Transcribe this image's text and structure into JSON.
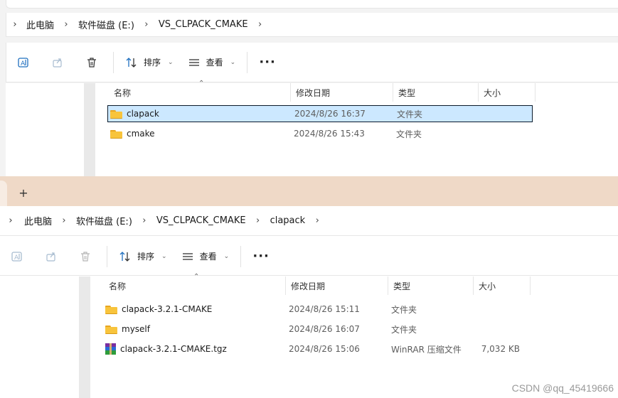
{
  "window_top": {
    "breadcrumb": [
      "此电脑",
      "软件磁盘 (E:)",
      "VS_CLPACK_CMAKE"
    ],
    "toolbar": {
      "sort_label": "排序",
      "view_label": "查看",
      "more_label": "···"
    },
    "columns": {
      "name": "名称",
      "date": "修改日期",
      "type": "类型",
      "size": "大小"
    },
    "files": [
      {
        "name": "clapack",
        "date": "2024/8/26 16:37",
        "type": "文件夹",
        "size": "",
        "icon": "folder-icon",
        "selected": true
      },
      {
        "name": "cmake",
        "date": "2024/8/26 15:43",
        "type": "文件夹",
        "size": "",
        "icon": "folder-icon",
        "selected": false
      }
    ]
  },
  "window_bottom": {
    "new_tab_label": "+",
    "breadcrumb": [
      "此电脑",
      "软件磁盘 (E:)",
      "VS_CLPACK_CMAKE",
      "clapack"
    ],
    "toolbar": {
      "sort_label": "排序",
      "view_label": "查看",
      "more_label": "···"
    },
    "columns": {
      "name": "名称",
      "date": "修改日期",
      "type": "类型",
      "size": "大小"
    },
    "files": [
      {
        "name": "clapack-3.2.1-CMAKE",
        "date": "2024/8/26 15:11",
        "type": "文件夹",
        "size": "",
        "icon": "folder-icon"
      },
      {
        "name": "myself",
        "date": "2024/8/26 16:07",
        "type": "文件夹",
        "size": "",
        "icon": "folder-icon"
      },
      {
        "name": "clapack-3.2.1-CMAKE.tgz",
        "date": "2024/8/26 15:06",
        "type": "WinRAR 压缩文件",
        "size": "7,032 KB",
        "icon": "winrar-archive-icon"
      }
    ]
  },
  "watermark": "CSDN @qq_45419666",
  "colors": {
    "selection_bg": "#cce8ff",
    "tab_bar": "#efd9c7",
    "folder": "#f8c43c"
  }
}
